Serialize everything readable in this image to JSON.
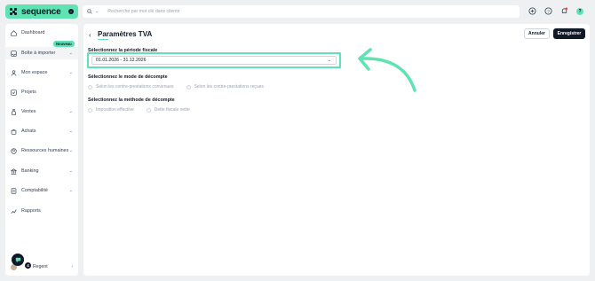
{
  "app": {
    "logo_text": "sequence",
    "logo_badge": "⌄"
  },
  "search": {
    "placeholder": "Recherche par mot clé dans clients"
  },
  "topbar": {
    "avatar_letter": "?"
  },
  "sidebar": {
    "items": [
      {
        "label": "Dashboard",
        "icon": "home-icon"
      },
      {
        "label": "Boîte à importer",
        "icon": "inbox-icon",
        "badge": "Nouveau"
      },
      {
        "label": "Mon espace",
        "icon": "user-icon"
      },
      {
        "label": "Projets",
        "icon": "check-square-icon"
      },
      {
        "label": "Ventes",
        "icon": "money-bag-icon"
      },
      {
        "label": "Achats",
        "icon": "bag-icon"
      },
      {
        "label": "Ressources humaines",
        "icon": "people-icon"
      },
      {
        "label": "Banking",
        "icon": "bank-icon"
      },
      {
        "label": "Comptabilité",
        "icon": "ledger-icon"
      },
      {
        "label": "Rapports",
        "icon": "chart-icon"
      }
    ],
    "user_name": "Regent",
    "chat_count": "4"
  },
  "main": {
    "title": "Paramètres TVA",
    "cancel_label": "Annuler",
    "save_label": "Enregistrer",
    "fiscal_period_label": "Sélectionnez la période fiscale",
    "fiscal_period_value": "01.01.2026 - 31.12.2026",
    "mode_label": "Sélectionnez le mode de décompte",
    "mode_options": [
      "Selon les contre-prestations convenues",
      "Selon les contre-prestations reçues"
    ],
    "method_label": "Sélectionnez la méthode de décompte",
    "method_options": [
      "Imposition effective",
      "Dette fiscale nette"
    ]
  },
  "colors": {
    "accent": "#5fe3b3",
    "dark": "#111827"
  }
}
